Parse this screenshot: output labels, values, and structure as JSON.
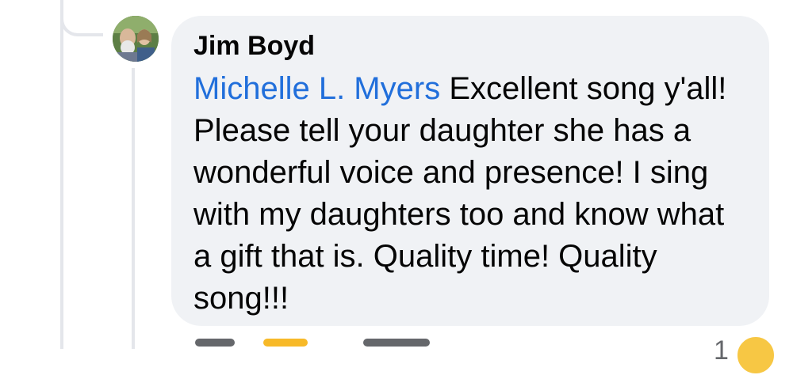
{
  "comment": {
    "author": "Jim Boyd",
    "mention": "Michelle L. Myers",
    "text": " Excellent song y'all! Please tell your daughter she has a wonderful voice and presence! I sing with my daughters too and know what a gift that is. Quality time! Quality song!!!"
  },
  "reactions": {
    "count": "1"
  },
  "colors": {
    "bubble": "#f0f2f5",
    "mention": "#216fdb",
    "thread_line": "#e4e6eb"
  }
}
